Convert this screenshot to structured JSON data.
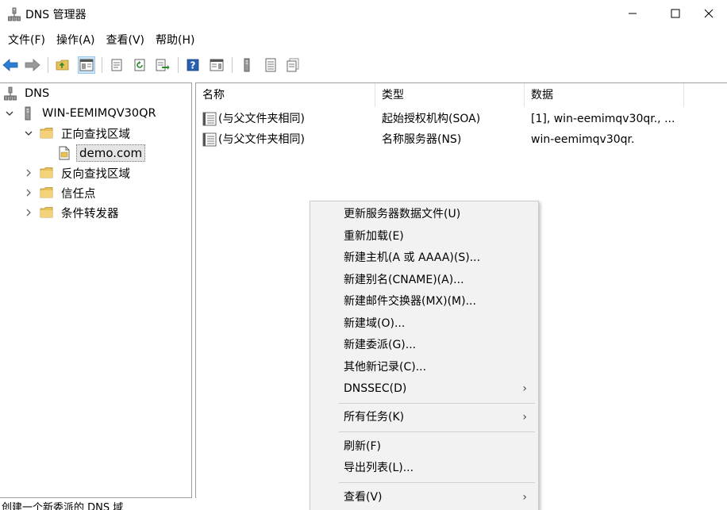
{
  "window": {
    "title": "DNS 管理器",
    "controls": {
      "minimize": "minimize",
      "maximize": "maximize",
      "close": "close"
    }
  },
  "menubar": [
    {
      "label": "文件(F)"
    },
    {
      "label": "操作(A)"
    },
    {
      "label": "查看(V)"
    },
    {
      "label": "帮助(H)"
    }
  ],
  "toolbar": {
    "buttons": [
      "back-arrow-icon",
      "forward-arrow-icon",
      "up-folder-icon",
      "show-hide-tree-icon",
      "properties-icon",
      "refresh-icon",
      "export-list-icon",
      "help-icon",
      "show-hide-action-pane-icon",
      "server-icon",
      "list-icon",
      "copy-icon"
    ],
    "active_button": "show-hide-tree-icon"
  },
  "tree": {
    "root": "DNS",
    "server": "WIN-EEMIMQV30QR",
    "forward_zones": "正向查找区域",
    "selected_zone": "demo.com",
    "reverse_zones": "反向查找区域",
    "trust_points": "信任点",
    "conditional_forwarders": "条件转发器"
  },
  "list": {
    "columns": {
      "name": "名称",
      "type": "类型",
      "data": "数据"
    },
    "rows": [
      {
        "name": "(与父文件夹相同)",
        "type": "起始授权机构(SOA)",
        "data": "[1], win-eemimqv30qr., ..."
      },
      {
        "name": "(与父文件夹相同)",
        "type": "名称服务器(NS)",
        "data": "win-eemimqv30qr."
      }
    ]
  },
  "context_menu": {
    "items": [
      {
        "label": "更新服务器数据文件(U)"
      },
      {
        "label": "重新加载(E)"
      },
      {
        "label": "新建主机(A 或 AAAA)(S)..."
      },
      {
        "label": "新建别名(CNAME)(A)..."
      },
      {
        "label": "新建邮件交换器(MX)(M)..."
      },
      {
        "label": "新建域(O)..."
      },
      {
        "label": "新建委派(G)..."
      },
      {
        "label": "其他新记录(C)..."
      },
      {
        "label": "DNSSEC(D)",
        "submenu": true
      },
      {
        "label": "所有任务(K)",
        "submenu": true
      },
      {
        "label": "刷新(F)"
      },
      {
        "label": "导出列表(L)..."
      },
      {
        "label": "查看(V)",
        "submenu": true
      }
    ],
    "submenu_arrow": "›"
  },
  "statusbar": {
    "text": "创建一个新委派的 DNS 域"
  },
  "colors": {
    "selection": "#cce4f7",
    "menu_bg": "#f2f2f2",
    "folder": "#e8c15a",
    "arrow_blue": "#2a7fd4"
  }
}
